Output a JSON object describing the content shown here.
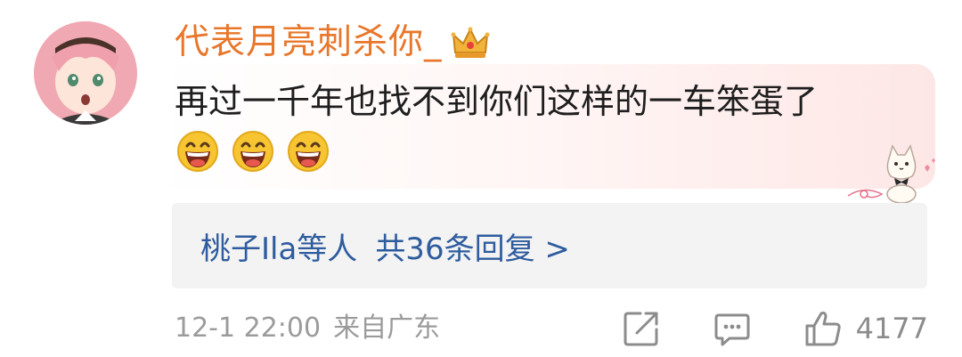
{
  "comment": {
    "username": "代表月亮刺杀你_",
    "text": "再过一千年也找不到你们这样的一车笨蛋了",
    "emojis": [
      "grinning-face-icon",
      "grinning-face-icon",
      "grinning-face-icon"
    ]
  },
  "replies": {
    "who": "桃子Ila等人",
    "count_text": "共36条回复 >"
  },
  "meta": {
    "time": "12-1 22:00",
    "source": "来自广东"
  },
  "actions": {
    "like_count": "4177"
  },
  "colors": {
    "username": "#e8772b",
    "link": "#2e5c9e",
    "meta": "#9b9b9b",
    "reply_bg": "#f3f3f3"
  }
}
